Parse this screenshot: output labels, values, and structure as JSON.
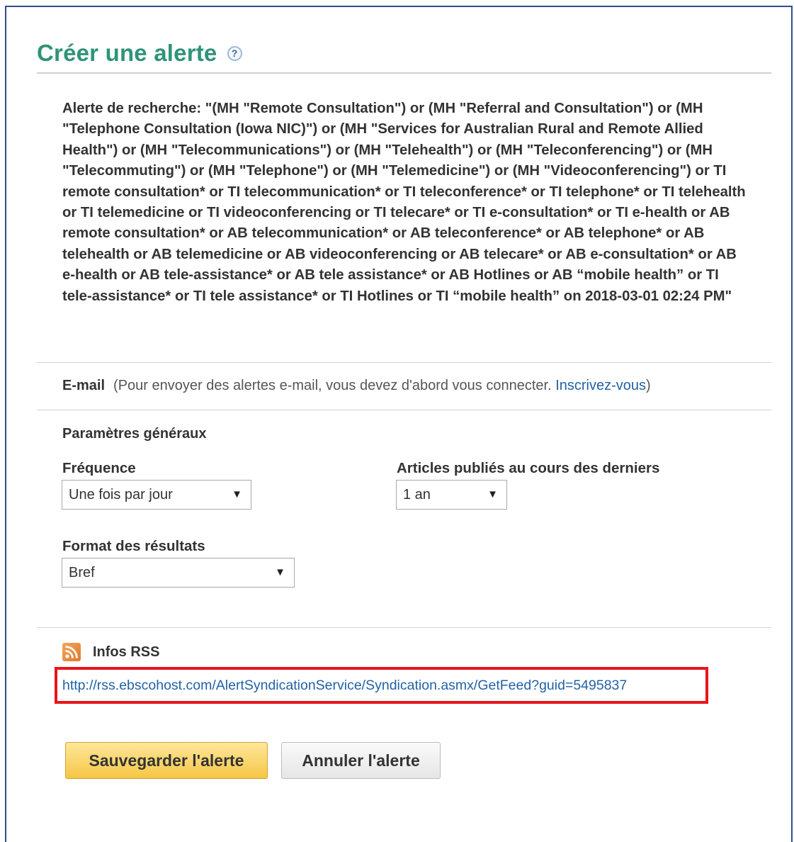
{
  "title": "Créer une alerte",
  "help_icon_glyph": "?",
  "query_text": "Alerte de recherche: \"(MH \"Remote Consultation\") or (MH \"Referral and Consultation\") or (MH \"Telephone Consultation (Iowa NIC)\") or (MH \"Services for Australian Rural and Remote Allied Health\") or (MH \"Telecommunications\") or (MH \"Telehealth\") or (MH \"Teleconferencing\") or (MH \"Telecommuting\") or (MH \"Telephone\") or (MH \"Telemedicine\") or (MH \"Videoconferencing\") or TI remote consultation* or TI telecommunication* or TI teleconference* or TI telephone* or TI telehealth or TI telemedicine or TI videoconferencing or TI telecare* or TI e-consultation* or TI e-health or AB remote consultation* or AB telecommunication* or AB teleconference* or AB telephone* or AB telehealth or AB telemedicine or AB videoconferencing or AB telecare* or AB e-consultation* or AB e-health or AB tele-assistance* or AB tele assistance* or AB Hotlines or AB “mobile health” or TI tele-assistance* or TI tele assistance* or TI Hotlines or TI “mobile health” on 2018-03-01 02:24 PM\"",
  "email": {
    "label": "E-mail",
    "note_prefix": "(Pour envoyer des alertes e-mail, vous devez d'abord vous connecter. ",
    "link": "Inscrivez-vous",
    "note_suffix": ")"
  },
  "settings": {
    "heading": "Paramètres généraux",
    "frequency_label": "Fréquence",
    "frequency_value": "Une fois par jour",
    "period_label": "Articles publiés au cours des derniers",
    "period_value": "1 an",
    "format_label": "Format des résultats",
    "format_value": "Bref",
    "dropdown_glyph": "▼"
  },
  "rss": {
    "label": "Infos RSS",
    "url": "http://rss.ebscohost.com/AlertSyndicationService/Syndication.asmx/GetFeed?guid=5495837"
  },
  "buttons": {
    "save": "Sauvegarder l'alerte",
    "cancel": "Annuler l'alerte"
  },
  "colors": {
    "title": "#2e9478",
    "link": "#2262a6",
    "highlight_box": "#e8151b",
    "save_button": "#f6c645"
  }
}
